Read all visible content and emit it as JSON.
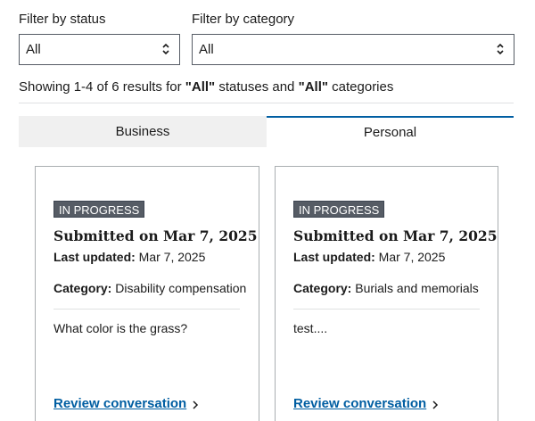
{
  "filters": {
    "status": {
      "label": "Filter by status",
      "selected": "All"
    },
    "category": {
      "label": "Filter by category",
      "selected": "All"
    }
  },
  "results_summary": {
    "prefix": "Showing 1-4 of 6 results for ",
    "status_value": "\"All\"",
    "middle": " statuses and ",
    "category_value": "\"All\"",
    "suffix": " categories"
  },
  "tabs": [
    {
      "label": "Business",
      "active": false
    },
    {
      "label": "Personal",
      "active": true
    }
  ],
  "cards": [
    {
      "status": "IN PROGRESS",
      "title": "Submitted on Mar 7, 2025",
      "updated_label": "Last updated:",
      "updated_value": " Mar 7, 2025",
      "category_label": "Category:",
      "category_value": " Disability compensation",
      "question": "What color is the grass?",
      "link": "Review conversation"
    },
    {
      "status": "IN PROGRESS",
      "title": "Submitted on Mar 7, 2025",
      "updated_label": "Last updated:",
      "updated_value": " Mar 7, 2025",
      "category_label": "Category:",
      "category_value": " Burials and memorials",
      "question": "test....",
      "link": "Review conversation"
    }
  ],
  "colors": {
    "link": "#005ea2",
    "badge_bg": "#565c65",
    "active_tab_border": "#005ea2",
    "inactive_tab_bg": "#f0f0f0"
  },
  "icons": {
    "select_chevron": "unfold-chevron-icon",
    "link_chevron": "chevron-right-icon"
  }
}
